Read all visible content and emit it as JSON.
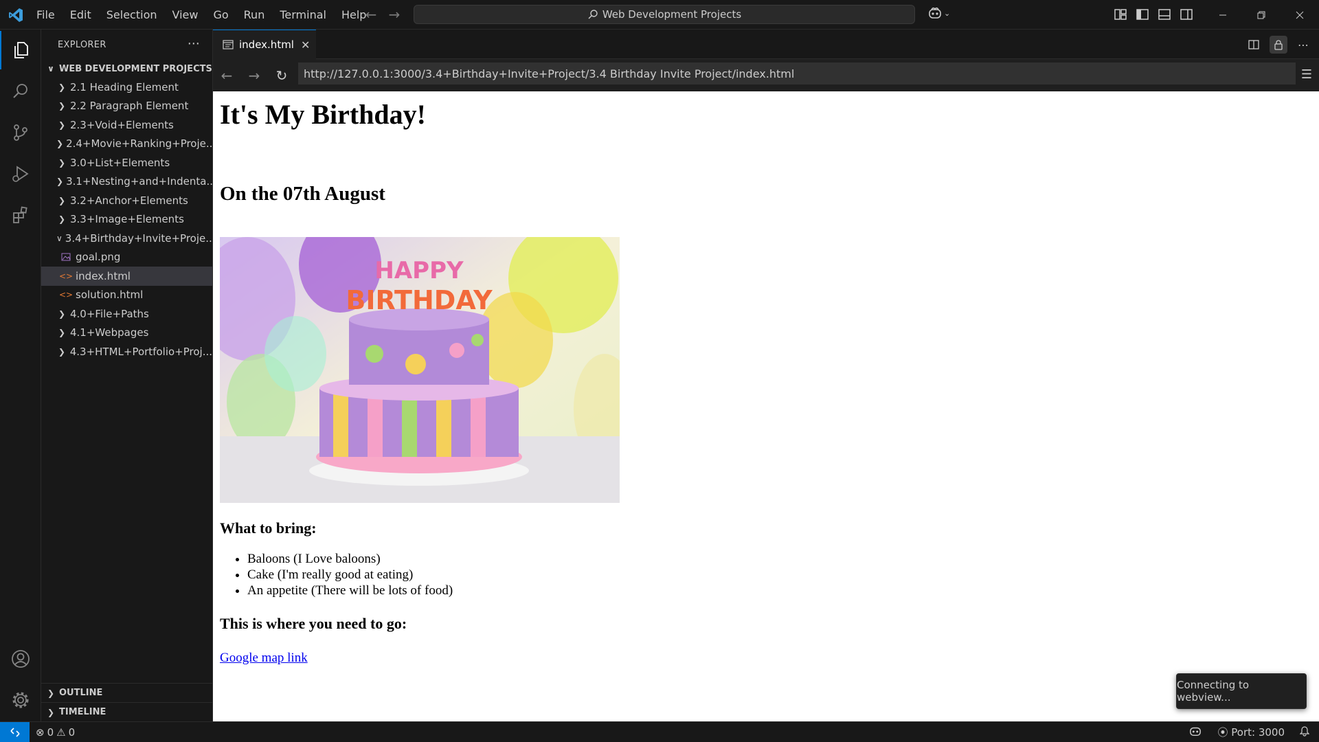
{
  "menu": [
    "File",
    "Edit",
    "Selection",
    "View",
    "Go",
    "Run",
    "Terminal",
    "Help"
  ],
  "search": {
    "text": "Web Development Projects"
  },
  "sidebar": {
    "title": "EXPLORER",
    "project": "WEB DEVELOPMENT PROJECTS",
    "items": [
      {
        "label": "2.1 Heading Element",
        "type": "folder",
        "open": false
      },
      {
        "label": "2.2 Paragraph Element",
        "type": "folder",
        "open": false
      },
      {
        "label": "2.3+Void+Elements",
        "type": "folder",
        "open": false
      },
      {
        "label": "2.4+Movie+Ranking+Proje...",
        "type": "folder",
        "open": false
      },
      {
        "label": "3.0+List+Elements",
        "type": "folder",
        "open": false
      },
      {
        "label": "3.1+Nesting+and+Indenta...",
        "type": "folder",
        "open": false
      },
      {
        "label": "3.2+Anchor+Elements",
        "type": "folder",
        "open": false
      },
      {
        "label": "3.3+Image+Elements",
        "type": "folder",
        "open": false
      },
      {
        "label": "3.4+Birthday+Invite+Proje...",
        "type": "folder",
        "open": true
      },
      {
        "label": "goal.png",
        "type": "image"
      },
      {
        "label": "index.html",
        "type": "html",
        "selected": true
      },
      {
        "label": "solution.html",
        "type": "html"
      },
      {
        "label": "4.0+File+Paths",
        "type": "folder",
        "open": false
      },
      {
        "label": "4.1+Webpages",
        "type": "folder",
        "open": false
      },
      {
        "label": "4.3+HTML+Portfolio+Proj...",
        "type": "folder",
        "open": false
      }
    ],
    "outline": "OUTLINE",
    "timeline": "TIMELINE"
  },
  "editor": {
    "tab_label": "index.html",
    "url": "http://127.0.0.1:3000/3.4+Birthday+Invite+Project/3.4 Birthday Invite Project/index.html"
  },
  "page": {
    "h1": "It's My Birthday!",
    "h2": "On the 07th August",
    "bring_heading": "What to bring:",
    "bring_items": [
      "Baloons (I Love baloons)",
      "Cake (I'm really good at eating)",
      "An appetite (There will be lots of food)"
    ],
    "go_heading": "This is where you need to go:",
    "link": "Google map link"
  },
  "toast": "Connecting to webview...",
  "statusbar": {
    "errors": "0",
    "warnings": "0",
    "port": "Port: 3000"
  },
  "colors": {
    "accent": "#0078d4",
    "link": "#0000ee",
    "html_icon": "#e37933"
  }
}
